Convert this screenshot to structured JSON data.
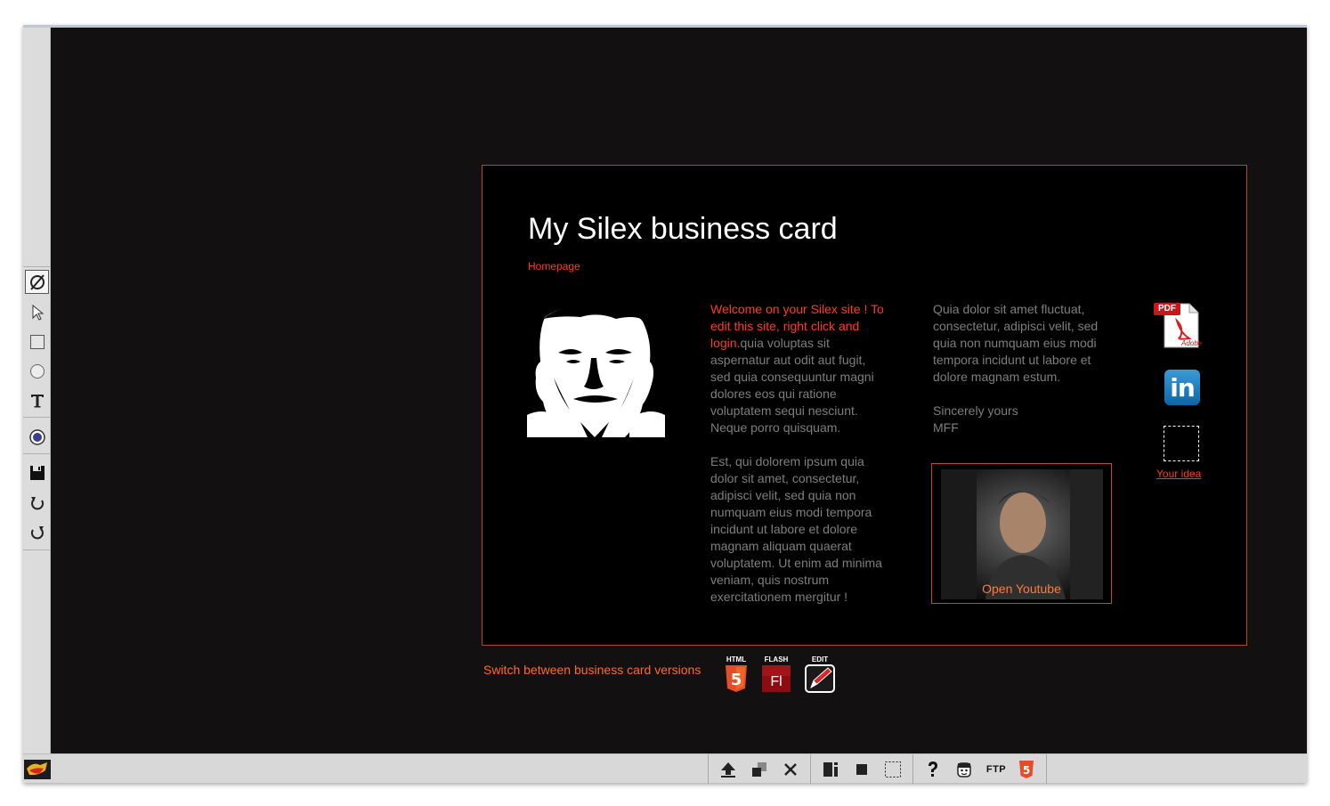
{
  "card": {
    "title": "My Silex business card",
    "homepage_link": "Homepage",
    "intro_highlight": "Welcome on your Silex site ! To edit this site, right click and login.",
    "intro_text": "quia voluptas sit aspernatur aut odit aut fugit, sed quia consequuntur magni dolores eos qui ratione voluptatem sequi nesciunt. Neque porro quisquam.",
    "paragraph2": "Est, qui dolorem ipsum quia dolor sit amet, consectetur, adipisci velit, sed quia non numquam eius modi tempora incidunt ut labore et dolore magnam aliquam quaerat voluptatem. Ut enim ad minima veniam, quis nostrum exercitationem mergitur !",
    "col2_text": "Quia dolor sit amet fluctuat, consectetur, adipisci velit, sed quia non numquam eius modi tempora incidunt ut labore et dolore magnam estum.",
    "sign_off": "Sincerely yours",
    "signature": "MFF",
    "video_label": "Open Youtube",
    "idea_link": "Your idea",
    "pdf_badge": "PDF",
    "pdf_brand": "Adobe",
    "linkedin_text": "in",
    "switch_text": "Switch between business card versions",
    "versions": [
      {
        "tag": "HTML",
        "glyph": "5"
      },
      {
        "tag": "FLASH",
        "glyph": "Fl"
      },
      {
        "tag": "EDIT",
        "glyph": ""
      }
    ]
  },
  "colors": {
    "stage_bg": "#121010",
    "card_bg": "#000000",
    "card_border": "#b8452a",
    "accent_red": "#ff3b1f",
    "accent_orange": "#ff6a2a",
    "body_text": "#7e7e7e",
    "toolbar_bg": "#d6d6d6"
  },
  "left_toolbar": {
    "tools": [
      "no-selection-icon",
      "pointer-icon",
      "rectangle-icon",
      "circle-icon",
      "text-icon",
      "record-icon",
      "save-icon",
      "undo-icon",
      "redo-icon"
    ]
  },
  "bottom_toolbar": {
    "buttons": [
      "upload-icon",
      "arrange-icon",
      "close-icon",
      "panel-icon",
      "fill-icon",
      "selection-icon",
      "help-icon",
      "avatar-icon",
      "ftp-icon",
      "html5-icon"
    ],
    "ftp_label": "FTP",
    "html5_glyph": "5"
  }
}
